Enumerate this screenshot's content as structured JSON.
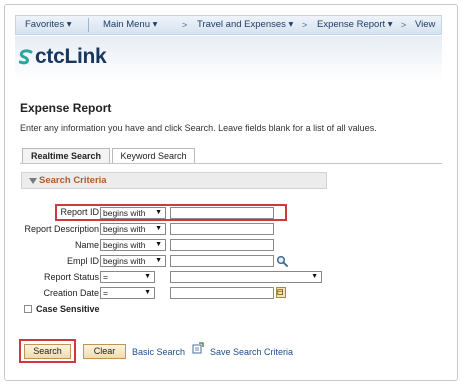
{
  "nav": {
    "favorites": "Favorites",
    "main_menu": "Main Menu",
    "travel": "Travel and Expenses",
    "expense_report": "Expense Report",
    "view": "View",
    "dropdown_glyph": "▾",
    "separator_glyph": ">"
  },
  "logo": {
    "text": "ctcLink"
  },
  "page": {
    "title": "Expense Report",
    "instructions": "Enter any information you have and click Search. Leave fields blank for a list of all values."
  },
  "tabs": {
    "realtime": "Realtime Search",
    "keyword": "Keyword Search"
  },
  "criteria": {
    "header": "Search Criteria",
    "fields": {
      "report_id": {
        "label": "Report ID",
        "operator": "begins with",
        "value": ""
      },
      "report_description": {
        "label": "Report Description",
        "operator": "begins with",
        "value": ""
      },
      "name": {
        "label": "Name",
        "operator": "begins with",
        "value": ""
      },
      "empl_id": {
        "label": "Empl ID",
        "operator": "begins with",
        "value": ""
      },
      "report_status": {
        "label": "Report Status",
        "operator": "=",
        "value": ""
      },
      "creation_date": {
        "label": "Creation Date",
        "operator": "=",
        "value": ""
      }
    },
    "dropdown_arrow": "▼",
    "case_sensitive": "Case Sensitive"
  },
  "buttons": {
    "search": "Search",
    "clear": "Clear",
    "basic_search": "Basic Search",
    "save_criteria": "Save Search Criteria"
  },
  "colors": {
    "highlight": "#d0393b",
    "nav_text": "#1f3d66",
    "criteria_text": "#b05a2a",
    "link": "#1d4e8a"
  }
}
